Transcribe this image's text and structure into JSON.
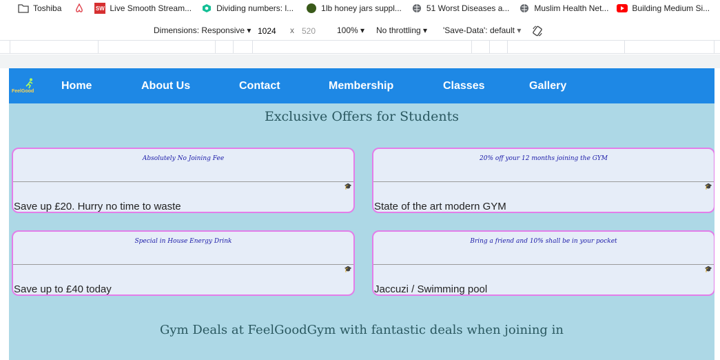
{
  "bookmarks": [
    {
      "label": "Toshiba",
      "icon": "folder-icon"
    },
    {
      "label": "",
      "icon": "airbnb-icon"
    },
    {
      "label": "Live Smooth Stream...",
      "icon": "sw-icon"
    },
    {
      "label": "Dividing numbers: l...",
      "icon": "khan-icon"
    },
    {
      "label": "1lb honey jars suppl...",
      "icon": "dot-icon"
    },
    {
      "label": "51 Worst Diseases a...",
      "icon": "globe-icon"
    },
    {
      "label": "Muslim Health Net...",
      "icon": "globe-icon"
    },
    {
      "label": "Building Medium Si...",
      "icon": "youtube-icon"
    }
  ],
  "devtools": {
    "dimensions_label": "Dimensions: Responsive",
    "width": "1024",
    "times": "x",
    "height": "520",
    "zoom": "100%",
    "throttle": "No throttling",
    "save_data": "'Save-Data': default"
  },
  "site": {
    "logo_text": "FeelGood",
    "nav": [
      "Home",
      "About Us",
      "Contact",
      "Membership",
      "Classes",
      "Gallery"
    ],
    "heading": "Exclusive Offers for Students",
    "cards": [
      {
        "subtitle": "Absolutely No Joining Fee",
        "title": "Save up £20. Hurry no time to waste"
      },
      {
        "subtitle": "20% off your 12 months joining the GYM",
        "title": "State of the art modern GYM"
      },
      {
        "subtitle": "Special in House Energy Drink",
        "title": "Save up to £40 today"
      },
      {
        "subtitle": "Bring a friend and 10% shall be in your pocket",
        "title": "Jaccuzi / Swimming pool"
      }
    ],
    "cap_icon": "graduation-cap-icon",
    "footer_heading": "Gym Deals at FeelGoodGym with fantastic deals when joining in"
  },
  "colors": {
    "nav": "#1e88e5",
    "page": "#add8e6",
    "card_border": "#e37de9",
    "card_bg": "#e6edf8",
    "subtitle": "#1a1aa8"
  }
}
